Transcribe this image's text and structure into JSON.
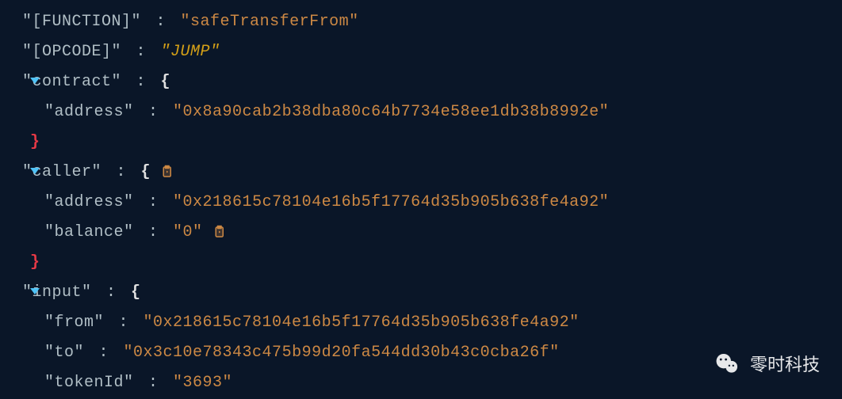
{
  "lines": [
    {
      "key": "\"[FUNCTION]\"",
      "val": "\"safeTransferFrom\"",
      "valClass": "val-str",
      "indent": 0,
      "arrow": false,
      "open": false,
      "close": false
    },
    {
      "key": "\"[OPCODE]\"",
      "val": "\"JUMP\"",
      "valClass": "val-yellow",
      "indent": 0,
      "arrow": false,
      "open": false,
      "close": false
    },
    {
      "key": "\"contract\"",
      "val": "",
      "valClass": "",
      "indent": 0,
      "arrow": true,
      "open": true,
      "close": false
    },
    {
      "key": "\"address\"",
      "val": "\"0x8a90cab2b38dba80c64b7734e58ee1db38b8992e\"",
      "valClass": "val-str",
      "indent": 1,
      "arrow": false,
      "open": false,
      "close": false
    },
    {
      "key": "",
      "val": "",
      "valClass": "",
      "indent": 0,
      "arrow": false,
      "open": false,
      "close": true
    },
    {
      "key": "\"caller\"",
      "val": "",
      "valClass": "",
      "indent": 0,
      "arrow": true,
      "open": true,
      "close": false,
      "clip": true
    },
    {
      "key": "\"address\"",
      "val": "\"0x218615c78104e16b5f17764d35b905b638fe4a92\"",
      "valClass": "val-str",
      "indent": 1,
      "arrow": false,
      "open": false,
      "close": false
    },
    {
      "key": "\"balance\"",
      "val": "\"0\"",
      "valClass": "val-str",
      "indent": 1,
      "arrow": false,
      "open": false,
      "close": false,
      "clip": true
    },
    {
      "key": "",
      "val": "",
      "valClass": "",
      "indent": 0,
      "arrow": false,
      "open": false,
      "close": true
    },
    {
      "key": "\"input\"",
      "val": "",
      "valClass": "",
      "indent": 0,
      "arrow": true,
      "open": true,
      "close": false
    },
    {
      "key": "\"from\"",
      "val": "\"0x218615c78104e16b5f17764d35b905b638fe4a92\"",
      "valClass": "val-str",
      "indent": 1,
      "arrow": false,
      "open": false,
      "close": false
    },
    {
      "key": "\"to\"",
      "val": "\"0x3c10e78343c475b99d20fa544dd30b43c0cba26f\"",
      "valClass": "val-str",
      "indent": 1,
      "arrow": false,
      "open": false,
      "close": false
    },
    {
      "key": "\"tokenId\"",
      "val": "\"3693\"",
      "valClass": "val-str",
      "indent": 1,
      "arrow": false,
      "open": false,
      "close": false
    }
  ],
  "watermark": "零时科技"
}
